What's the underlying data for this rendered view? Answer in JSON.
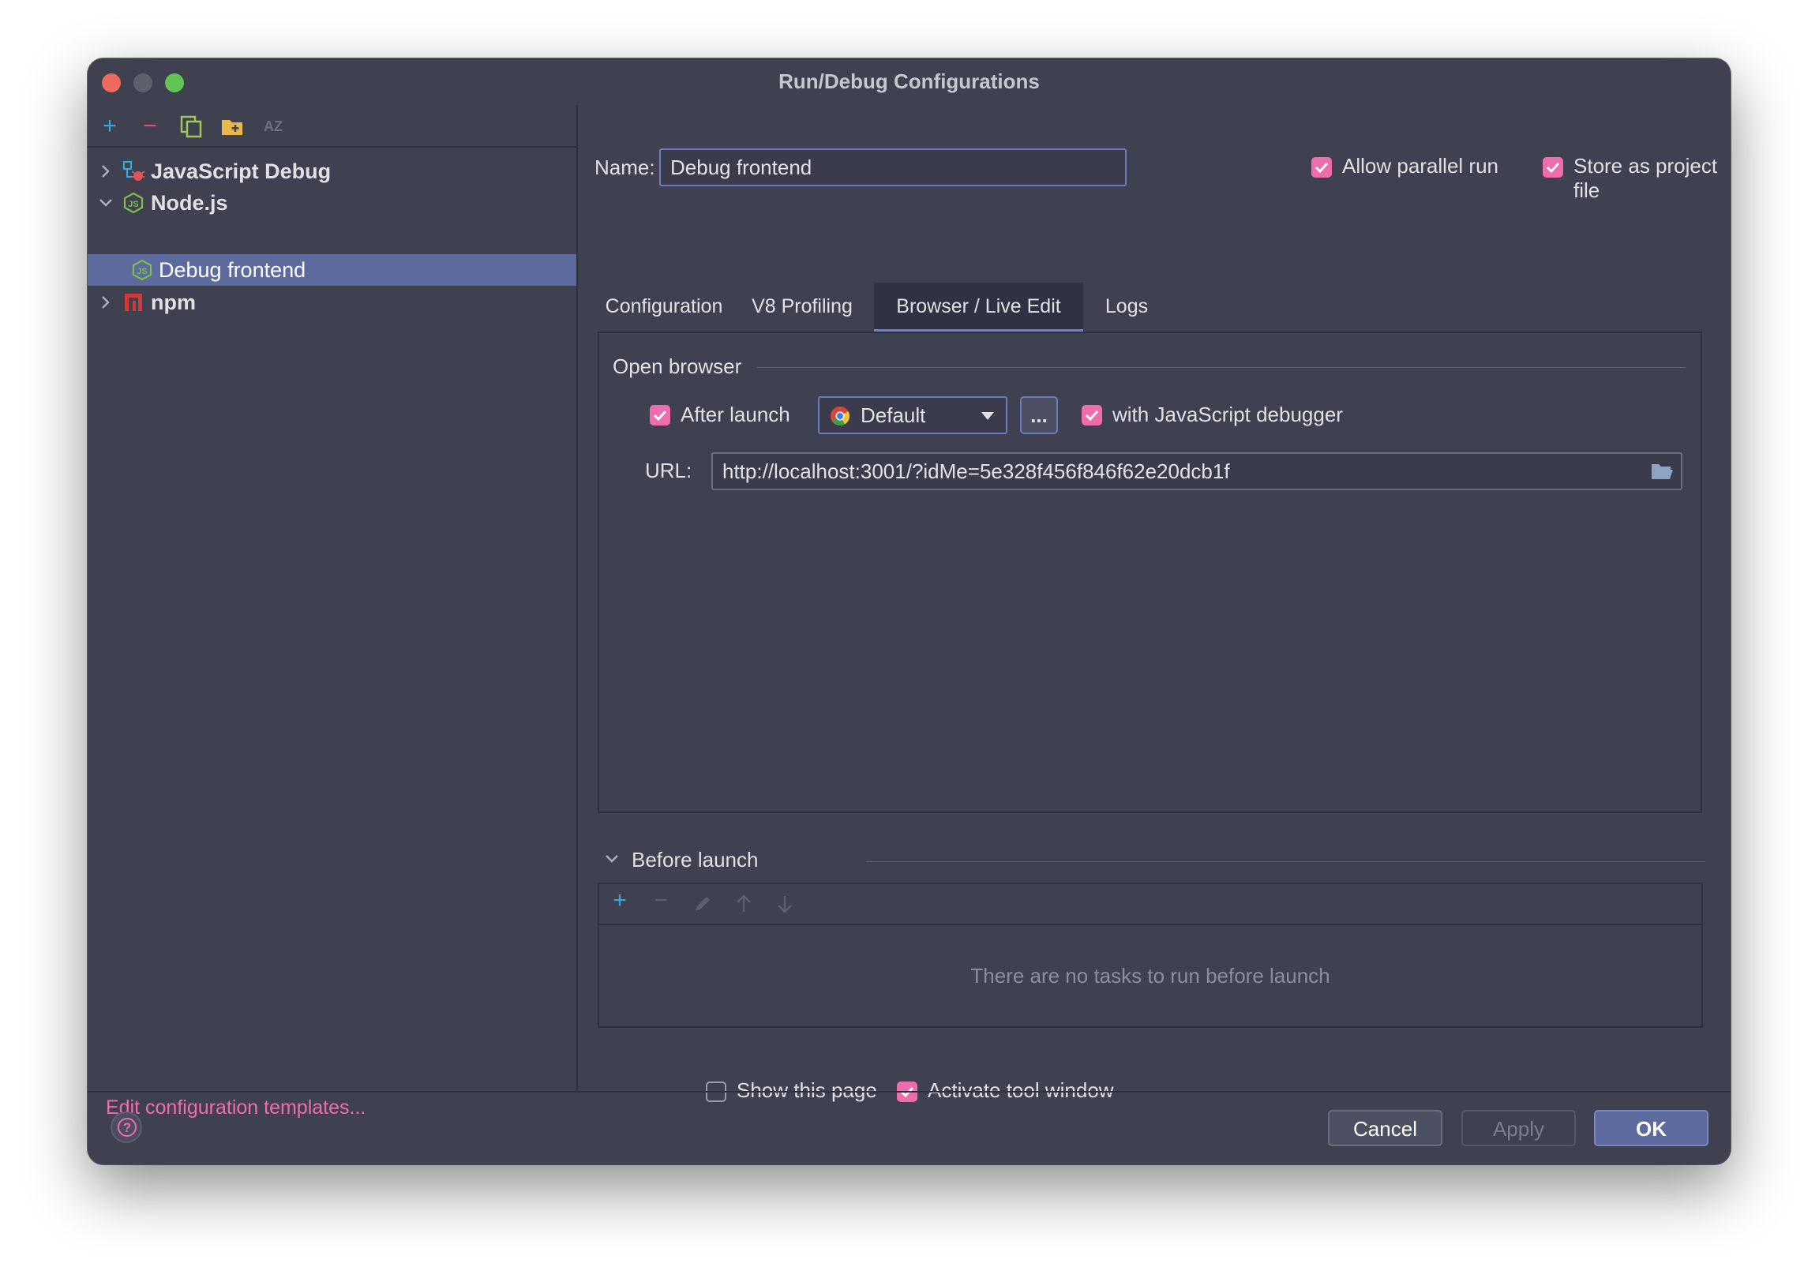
{
  "window": {
    "title": "Run/Debug Configurations"
  },
  "toolbar": {
    "add": "+",
    "remove": "−",
    "sort": "AZ"
  },
  "tree": [
    {
      "label": "JavaScript Debug",
      "expanded": false,
      "icon": "javascript-debug-icon"
    },
    {
      "label": "Node.js",
      "expanded": true,
      "icon": "nodejs-icon"
    },
    {
      "label": "Debug frontend",
      "selected": true,
      "icon": "nodejs-config-icon"
    },
    {
      "label": "npm",
      "expanded": false,
      "icon": "npm-icon"
    }
  ],
  "edit_templates_link": "Edit configuration templates...",
  "name_label": "Name:",
  "name_value": "Debug frontend",
  "allow_parallel_run": {
    "label": "Allow parallel run",
    "checked": true
  },
  "store_as_project_file": {
    "label": "Store as project file",
    "checked": true
  },
  "tabs": [
    {
      "label": "Configuration",
      "active": false
    },
    {
      "label": "V8 Profiling",
      "active": false
    },
    {
      "label": "Browser / Live Edit",
      "active": true
    },
    {
      "label": "Logs",
      "active": false
    }
  ],
  "open_browser": {
    "section_title": "Open browser",
    "after_launch": {
      "label": "After launch",
      "checked": true
    },
    "browser_select": "Default",
    "ellipsis_button": "...",
    "with_js_debugger": {
      "label": "with JavaScript debugger",
      "checked": true
    },
    "url_label": "URL:",
    "url_value": "http://localhost:3001/?idMe=5e328f456f846f62e20dcb1f"
  },
  "before_launch": {
    "title": "Before launch",
    "empty_text": "There are no tasks to run before launch",
    "add": "+",
    "remove": "−"
  },
  "show_this_page": {
    "label": "Show this page",
    "checked": false
  },
  "activate_tool_window": {
    "label": "Activate tool window",
    "checked": true
  },
  "buttons": {
    "cancel": "Cancel",
    "apply": "Apply",
    "ok": "OK",
    "help": "?"
  },
  "colors": {
    "accent": "#f06dad",
    "selection": "#5d6a9e",
    "background": "#3f4150",
    "ok_button": "#5d6a9e"
  }
}
